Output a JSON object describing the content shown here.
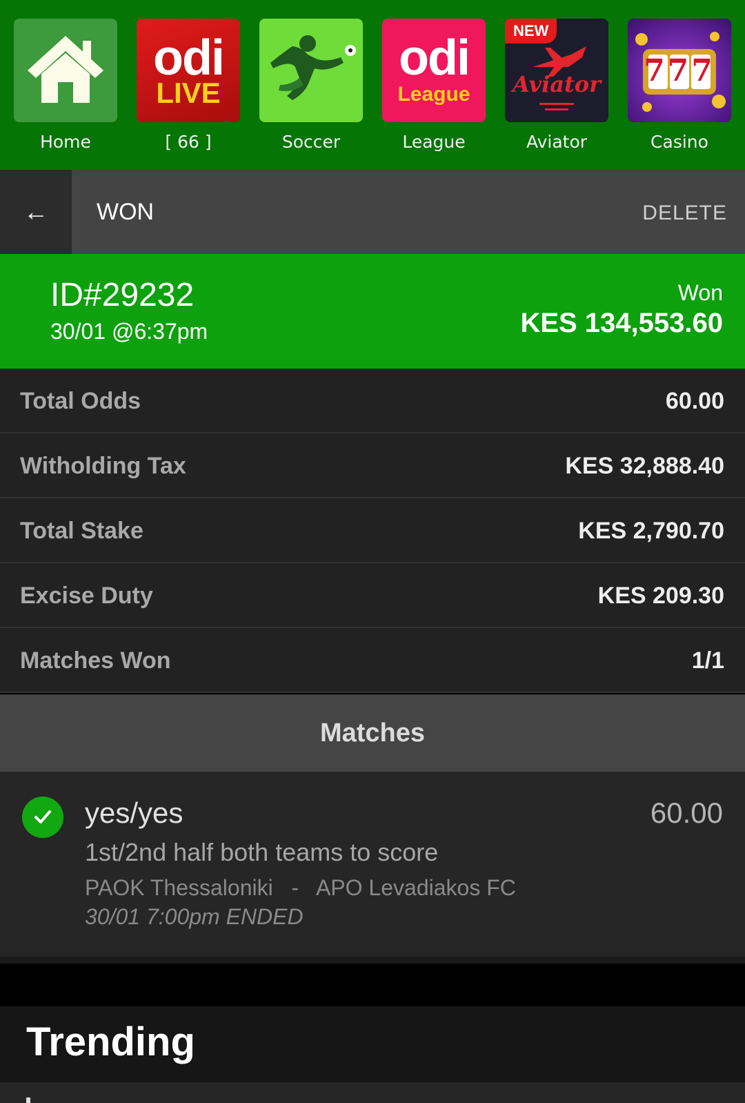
{
  "nav": {
    "items": [
      {
        "label": "Home"
      },
      {
        "label": "[ 66 ]",
        "tile_text": "odi",
        "tile_sub": "LIVE"
      },
      {
        "label": "Soccer"
      },
      {
        "label": "League",
        "tile_text": "odi",
        "tile_sub": "League"
      },
      {
        "label": "Aviator",
        "badge": "NEW",
        "tile_text": "Aviator"
      },
      {
        "label": "Casino",
        "tile_text": "777"
      }
    ]
  },
  "header": {
    "back_icon": "←",
    "title": "WON",
    "delete_label": "DELETE"
  },
  "bet": {
    "id": "ID#29232",
    "date": "30/01 @6:37pm",
    "status": "Won",
    "payout": "KES 134,553.60"
  },
  "summary": [
    {
      "label": "Total Odds",
      "value": "60.00"
    },
    {
      "label": "Witholding Tax",
      "value": "KES 32,888.40"
    },
    {
      "label": "Total Stake",
      "value": "KES 2,790.70"
    },
    {
      "label": "Excise Duty",
      "value": "KES 209.30"
    },
    {
      "label": "Matches Won",
      "value": "1/1"
    }
  ],
  "matches": {
    "title": "Matches",
    "items": [
      {
        "pick": "yes/yes",
        "odds": "60.00",
        "market": "1st/2nd half both teams to score",
        "teams": "PAOK Thessaloniki   -   APO Levadiakos FC",
        "time": "30/01 7:00pm ENDED",
        "status_icon": "check-icon"
      }
    ]
  },
  "trending": {
    "title": "Trending"
  },
  "colors": {
    "nav_bg": "#057505",
    "banner_green": "#0ea10e",
    "check_green": "#12a812",
    "row_bg": "#222222",
    "header_bg": "#444444"
  }
}
